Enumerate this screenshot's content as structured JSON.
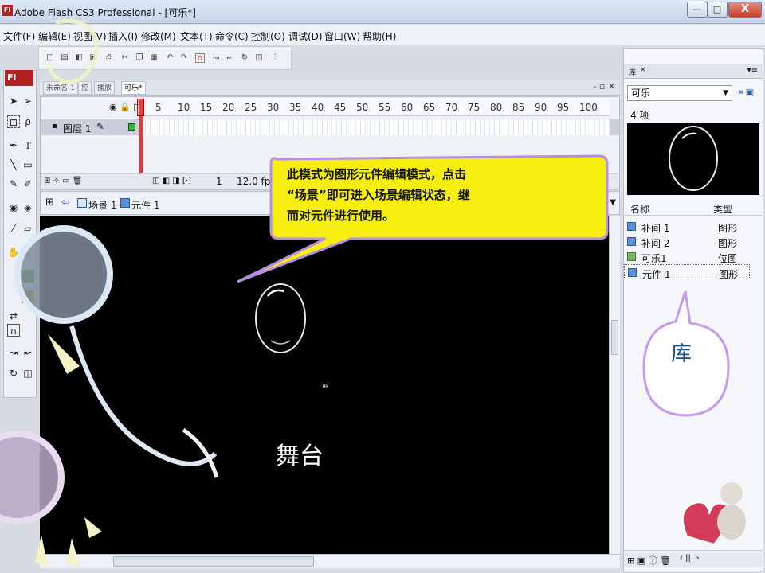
{
  "window": {
    "title": "Adobe Flash CS3 Professional - [可乐*]",
    "min": "—",
    "max": "□",
    "close": "X"
  },
  "menu": [
    "文件(F)",
    "编辑(E)",
    "视图(V)",
    "插入(I)",
    "修改(M)",
    "文本(T)",
    "命令(C)",
    "控制(O)",
    "调试(D)",
    "窗口(W)",
    "帮助(H)"
  ],
  "tools": {
    "logo": "Fl"
  },
  "doc_tabs": [
    "未命名-1",
    "控",
    "播放",
    "可乐*"
  ],
  "timeline": {
    "frame_numbers": [
      "5",
      "10",
      "15",
      "20",
      "25",
      "30",
      "35",
      "40",
      "45",
      "50",
      "55",
      "60",
      "65",
      "70",
      "75",
      "80",
      "85",
      "90",
      "95",
      "100"
    ],
    "layer_name": "图层 1",
    "current_frame": "1",
    "fps": "12.0 fps"
  },
  "breadcrumb": {
    "scene": "场景 1",
    "symbol": "元件 1"
  },
  "library": {
    "tab": "库",
    "document": "可乐",
    "count": "4 项",
    "col_name": "名称",
    "col_type": "类型",
    "items": [
      {
        "name": "补间 1",
        "type": "图形"
      },
      {
        "name": "补间 2",
        "type": "图形"
      },
      {
        "name": "可乐1",
        "type": "位图"
      },
      {
        "name": "元件 1",
        "type": "图形"
      }
    ]
  },
  "annotations": {
    "callout_lines": [
      "此模式为图形元件编辑模式，点击",
      "“场景”即可进入场景编辑状态，继",
      "而对元件进行使用。"
    ],
    "library_label": "库",
    "stage_label": "舞台"
  },
  "colors": {
    "callout_fill": "#f5ee10",
    "callout_border": "#b58ee6",
    "stage": "#000000"
  }
}
